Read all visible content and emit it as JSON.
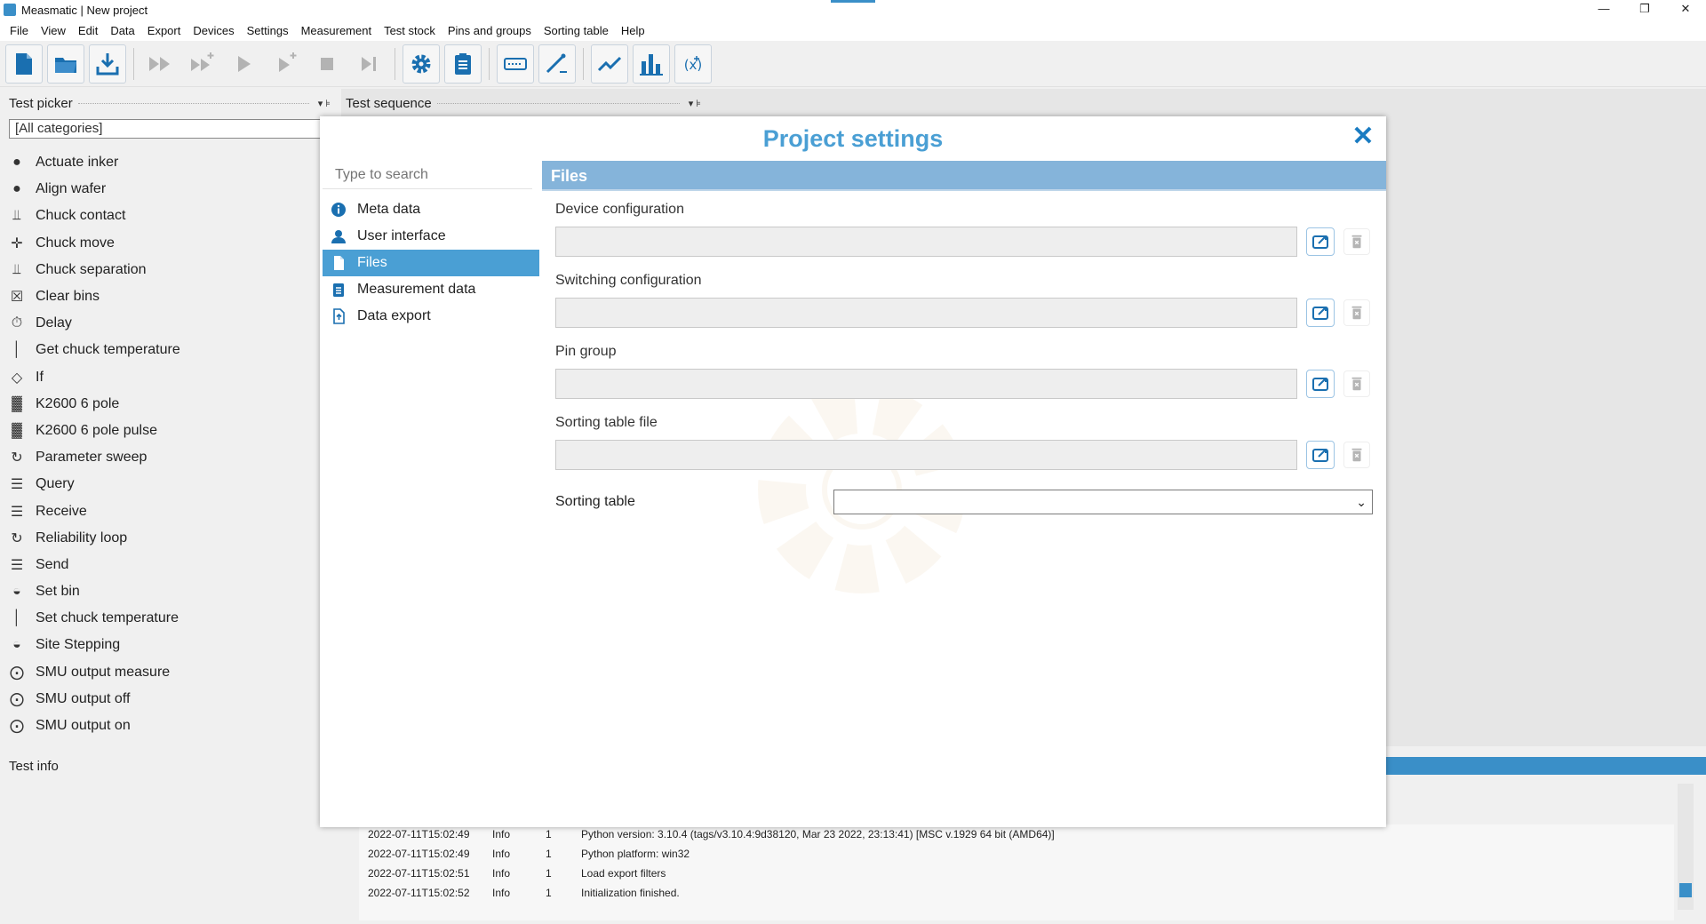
{
  "window": {
    "title": "Measmatic | New project",
    "controls": [
      "—",
      "❐",
      "✕"
    ]
  },
  "menu": [
    "File",
    "View",
    "Edit",
    "Data",
    "Export",
    "Devices",
    "Settings",
    "Measurement",
    "Test stock",
    "Pins and groups",
    "Sorting table",
    "Help"
  ],
  "toolbar": {
    "buttons": [
      {
        "icon": "new-file-icon",
        "enabled": true
      },
      {
        "icon": "open-folder-icon",
        "enabled": true
      },
      {
        "icon": "save-download-icon",
        "enabled": true
      },
      {
        "icon": "run-all-icon",
        "enabled": false
      },
      {
        "icon": "run-all-plus-icon",
        "enabled": false
      },
      {
        "icon": "play-icon",
        "enabled": false
      },
      {
        "icon": "play-plus-icon",
        "enabled": false
      },
      {
        "icon": "stop-icon",
        "enabled": false
      },
      {
        "icon": "skip-next-icon",
        "enabled": false
      },
      {
        "icon": "settings-gear-icon",
        "enabled": true
      },
      {
        "icon": "clipboard-icon",
        "enabled": true
      },
      {
        "icon": "terminal-icon",
        "enabled": true
      },
      {
        "icon": "probe-icon",
        "enabled": true
      },
      {
        "icon": "line-chart-icon",
        "enabled": true
      },
      {
        "icon": "bar-chart-icon",
        "enabled": true
      },
      {
        "icon": "formula-icon",
        "enabled": true
      }
    ],
    "accent": "#1a6fb0"
  },
  "test_picker": {
    "header": "Test picker",
    "category": "[All categories]",
    "items": [
      {
        "label": "Actuate inker",
        "icon": "inker-icon",
        "glyph": "●"
      },
      {
        "label": "Align wafer",
        "icon": "wafer-icon",
        "glyph": "●"
      },
      {
        "label": "Chuck contact",
        "icon": "chuck-contact-icon",
        "glyph": "⫫"
      },
      {
        "label": "Chuck move",
        "icon": "move-arrows-icon",
        "glyph": "✛"
      },
      {
        "label": "Chuck separation",
        "icon": "chuck-separation-icon",
        "glyph": "⫫"
      },
      {
        "label": "Clear bins",
        "icon": "clear-bins-icon",
        "glyph": "☒"
      },
      {
        "label": "Delay",
        "icon": "stopwatch-icon",
        "glyph": "⏱"
      },
      {
        "label": "Get chuck temperature",
        "icon": "thermometer-icon",
        "glyph": "│"
      },
      {
        "label": "If",
        "icon": "condition-icon",
        "glyph": "◇"
      },
      {
        "label": "K2600 6 pole",
        "icon": "k2600-icon",
        "glyph": "▓"
      },
      {
        "label": "K2600 6 pole pulse",
        "icon": "k2600-pulse-icon",
        "glyph": "▓"
      },
      {
        "label": "Parameter sweep",
        "icon": "loop-icon",
        "glyph": "↻"
      },
      {
        "label": "Query",
        "icon": "query-terminal-icon",
        "glyph": "☰"
      },
      {
        "label": "Receive",
        "icon": "receive-terminal-icon",
        "glyph": "☰"
      },
      {
        "label": "Reliability loop",
        "icon": "loop-icon",
        "glyph": "↻"
      },
      {
        "label": "Send",
        "icon": "send-terminal-icon",
        "glyph": "☰"
      },
      {
        "label": "Set bin",
        "icon": "set-bin-icon",
        "glyph": "◒"
      },
      {
        "label": "Set chuck temperature",
        "icon": "thermometer-icon",
        "glyph": "│"
      },
      {
        "label": "Site Stepping",
        "icon": "site-stepping-icon",
        "glyph": "◒"
      },
      {
        "label": "SMU output measure",
        "icon": "smu-icon",
        "glyph": "⨀"
      },
      {
        "label": "SMU output off",
        "icon": "smu-icon",
        "glyph": "⨀"
      },
      {
        "label": "SMU output on",
        "icon": "smu-icon",
        "glyph": "⨀"
      }
    ]
  },
  "test_info": {
    "header": "Test info"
  },
  "test_sequence": {
    "header": "Test sequence"
  },
  "log": {
    "rows": [
      {
        "time": "2022-07-11T15:02:49",
        "level": "Info",
        "n": "1",
        "msg": "Python version: 3.10.4 (tags/v3.10.4:9d38120, Mar 23 2022, 23:13:41) [MSC v.1929 64 bit (AMD64)]"
      },
      {
        "time": "2022-07-11T15:02:49",
        "level": "Info",
        "n": "1",
        "msg": "Python platform: win32"
      },
      {
        "time": "2022-07-11T15:02:51",
        "level": "Info",
        "n": "1",
        "msg": "Load export filters"
      },
      {
        "time": "2022-07-11T15:02:52",
        "level": "Info",
        "n": "1",
        "msg": "Initialization finished."
      }
    ]
  },
  "modal": {
    "title": "Project settings",
    "close": "✕",
    "search_placeholder": "Type to search",
    "nav": [
      {
        "label": "Meta data",
        "icon": "info-icon",
        "active": false
      },
      {
        "label": "User interface",
        "icon": "user-icon",
        "active": false
      },
      {
        "label": "Files",
        "icon": "file-icon",
        "active": true
      },
      {
        "label": "Measurement data",
        "icon": "clipboard-icon",
        "active": false
      },
      {
        "label": "Data export",
        "icon": "export-file-icon",
        "active": false
      }
    ],
    "section": "Files",
    "fields": [
      {
        "label": "Device configuration",
        "value": ""
      },
      {
        "label": "Switching configuration",
        "value": ""
      },
      {
        "label": "Pin group",
        "value": ""
      },
      {
        "label": "Sorting table file",
        "value": ""
      }
    ],
    "sorting_table": {
      "label": "Sorting table",
      "value": "",
      "arrow": "⌄"
    }
  },
  "colors": {
    "accent": "#4a9fd4",
    "section_bar": "#85b4da",
    "close": "#1a7cc2"
  }
}
